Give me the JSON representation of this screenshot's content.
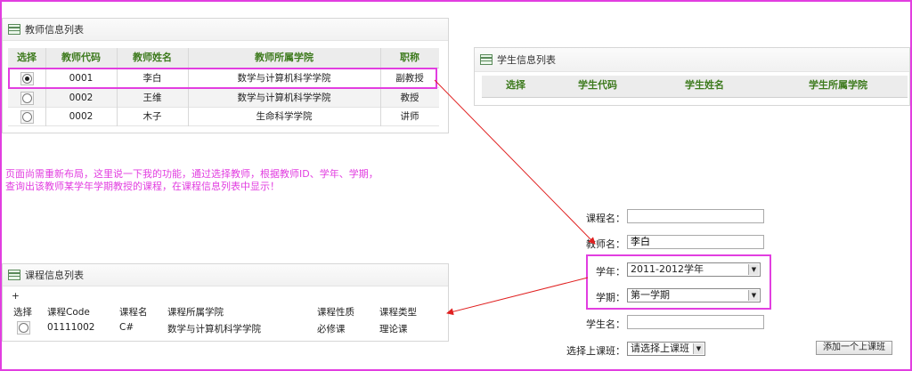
{
  "teacher_panel": {
    "title": "教师信息列表",
    "columns": [
      "选择",
      "教师代码",
      "教师姓名",
      "教师所属学院",
      "职称"
    ],
    "rows": [
      {
        "code": "0001",
        "name": "李白",
        "college": "数学与计算机科学学院",
        "title": "副教授",
        "selected": true
      },
      {
        "code": "0002",
        "name": "王维",
        "college": "数学与计算机科学学院",
        "title": "教授",
        "selected": false
      },
      {
        "code": "0002",
        "name": "木子",
        "college": "生命科学学院",
        "title": "讲师",
        "selected": false
      }
    ]
  },
  "student_panel": {
    "title": "学生信息列表",
    "columns": [
      "选择",
      "学生代码",
      "学生姓名",
      "学生所属学院"
    ]
  },
  "note": {
    "line1": "页面尚需重新布局，这里说一下我的功能，通过选择教师，根据教师ID、学年、学期，",
    "line2": "查询出该教师某学年学期教授的课程，在课程信息列表中显示！"
  },
  "course_panel": {
    "title": "课程信息列表",
    "plus": "+",
    "columns": [
      "选择",
      "课程Code",
      "课程名",
      "课程所属学院",
      "课程性质",
      "课程类型"
    ],
    "rows": [
      {
        "code": "01111002",
        "name": "C#",
        "college": "数学与计算机科学学院",
        "nature": "必修课",
        "type": "理论课"
      }
    ]
  },
  "form": {
    "course_name_label": "课程名：",
    "course_name_value": "",
    "teacher_name_label": "教师名：",
    "teacher_name_value": "李白",
    "year_label": "学年：",
    "year_value": "2011-2012学年",
    "term_label": "学期：",
    "term_value": "第一学期",
    "student_name_label": "学生名：",
    "student_name_value": "",
    "class_label": "选择上课班：",
    "class_value": "请选择上课班",
    "add_button": "添加一个上课班"
  },
  "colors": {
    "accent": "#e23ee0",
    "header_text": "#3d7a1d",
    "arrow": "#e02020"
  },
  "icons": [
    "grid-icon",
    "chevron-down-icon",
    "radio-icon"
  ]
}
